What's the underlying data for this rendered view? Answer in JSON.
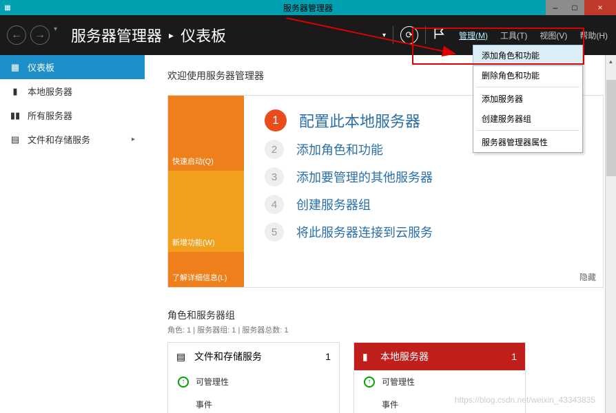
{
  "window": {
    "title": "服务器管理器",
    "controls": {
      "min": "–",
      "max": "□",
      "close": "×"
    }
  },
  "header": {
    "breadcrumb_app": "服务器管理器",
    "breadcrumb_sep": "▸",
    "breadcrumb_page": "仪表板",
    "dropdown_caret": "▾",
    "menu": {
      "manage": "管理(M)",
      "tools": "工具(T)",
      "view": "视图(V)",
      "help": "帮助(H)"
    }
  },
  "manage_menu": {
    "add_roles": "添加角色和功能",
    "remove_roles": "删除角色和功能",
    "add_servers": "添加服务器",
    "create_group": "创建服务器组",
    "properties": "服务器管理器属性"
  },
  "sidebar": {
    "dashboard": "仪表板",
    "local_server": "本地服务器",
    "all_servers": "所有服务器",
    "file_storage": "文件和存储服务",
    "chevron": "▸"
  },
  "main": {
    "welcome_title": "欢迎使用服务器管理器",
    "quick_start": "快速启动(Q)",
    "whats_new": "新增功能(W)",
    "learn_more": "了解详细信息(L)",
    "steps": {
      "s1": "配置此本地服务器",
      "s2": "添加角色和功能",
      "s3": "添加要管理的其他服务器",
      "s4": "创建服务器组",
      "s5": "将此服务器连接到云服务"
    },
    "step_nums": {
      "n1": "1",
      "n2": "2",
      "n3": "3",
      "n4": "4",
      "n5": "5"
    },
    "hide": "隐藏"
  },
  "roles": {
    "section_title": "角色和服务器组",
    "subtitle": "角色: 1 | 服务器组: 1 | 服务器总数: 1",
    "tile1": {
      "title": "文件和存储服务",
      "count": "1",
      "manage": "可管理性",
      "events": "事件"
    },
    "tile2": {
      "title": "本地服务器",
      "count": "1",
      "manage": "可管理性",
      "events": "事件"
    }
  },
  "watermark": "https://blog.csdn.net/weixin_43343835"
}
